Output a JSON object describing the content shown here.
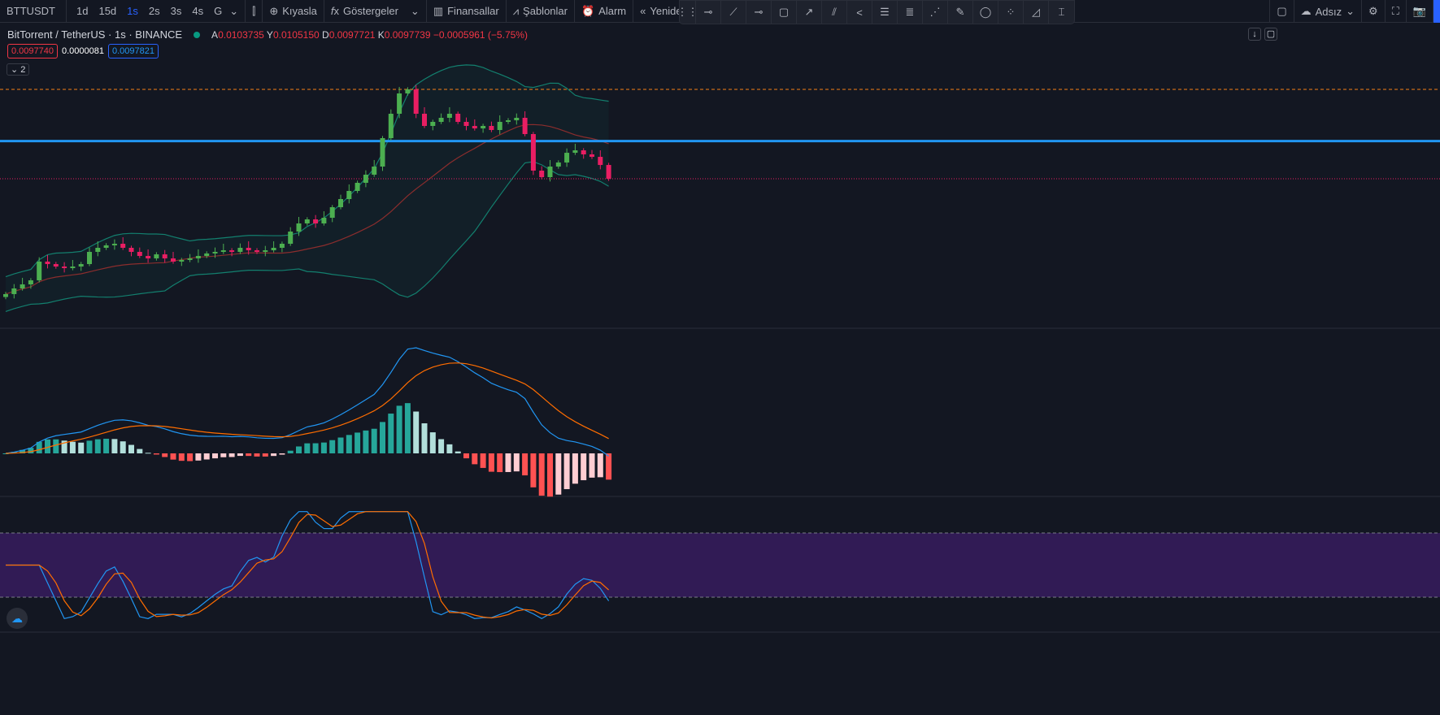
{
  "toolbar": {
    "symbol": "BTTUSDT",
    "timeframes": [
      "1d",
      "15d",
      "1s",
      "2s",
      "3s",
      "4s",
      "G"
    ],
    "active_timeframe": "1s",
    "compare": "Kıyasla",
    "indicators": "Göstergeler",
    "financials": "Finansallar",
    "templates": "Şablonlar",
    "alert": "Alarm",
    "replay": "Yeniden oyna",
    "layout_name": "Adsız"
  },
  "drawing_tools": [
    "horizontal-ray",
    "trend-line",
    "horizontal-line",
    "rectangle",
    "arrow",
    "parallel-lines",
    "path",
    "fib-lines",
    "fib-fan",
    "gann-fan",
    "brush",
    "ellipse",
    "pattern",
    "curve",
    "price-range"
  ],
  "legend": {
    "title": "BitTorrent / TetherUS · 1s · BINANCE",
    "o_label": "A",
    "o": "0.0103735",
    "h_label": "Y",
    "h": "0.0105150",
    "l_label": "D",
    "l": "0.0097721",
    "c_label": "K",
    "c": "0.0097739",
    "change": "−0.0005961 (−5.75%)",
    "sell": "0.0097740",
    "spread": "0.0000081",
    "buy": "0.0097821",
    "collapsed_count": "2"
  },
  "colors": {
    "bg": "#131722",
    "up": "#4caf50",
    "down": "#e91e63",
    "bb": "#137f6e",
    "basis": "#8b2d2d",
    "macd": "#2196f3",
    "signal": "#ff6d00",
    "stoch_k": "#2196f3",
    "stoch_d": "#ff6d00",
    "band": "#311b55",
    "hline": "#2196f3"
  },
  "chart_data": {
    "type": "candlestick",
    "symbol": "BTTUSDT",
    "levels": {
      "blue_line": 0.010034,
      "orange_dashed": 0.01039,
      "current_price": 0.0097739
    },
    "closes": [
      0.008979,
      0.009018,
      0.009046,
      0.009074,
      0.009203,
      0.009186,
      0.009169,
      0.009158,
      0.009169,
      0.009186,
      0.00927,
      0.009298,
      0.009315,
      0.009326,
      0.009298,
      0.00927,
      0.009242,
      0.009225,
      0.009253,
      0.009225,
      0.009203,
      0.009214,
      0.009225,
      0.009242,
      0.009259,
      0.00927,
      0.009281,
      0.00927,
      0.009298,
      0.009281,
      0.00927,
      0.009281,
      0.009298,
      0.009326,
      0.00941,
      0.009466,
      0.009494,
      0.009466,
      0.009505,
      0.009578,
      0.009634,
      0.00969,
      0.009746,
      0.009802,
      0.009858,
      0.010054,
      0.010222,
      0.010362,
      0.01039,
      0.010222,
      0.010138,
      0.010166,
      0.010194,
      0.010222,
      0.010166,
      0.010138,
      0.010121,
      0.010138,
      0.01011,
      0.010166,
      0.010177,
      0.010194,
      0.010082,
      0.00983,
      0.009785,
      0.009858,
      0.009886,
      0.009953,
      0.00997,
      0.009942,
      0.009925,
      0.009869,
      0.009774
    ]
  }
}
